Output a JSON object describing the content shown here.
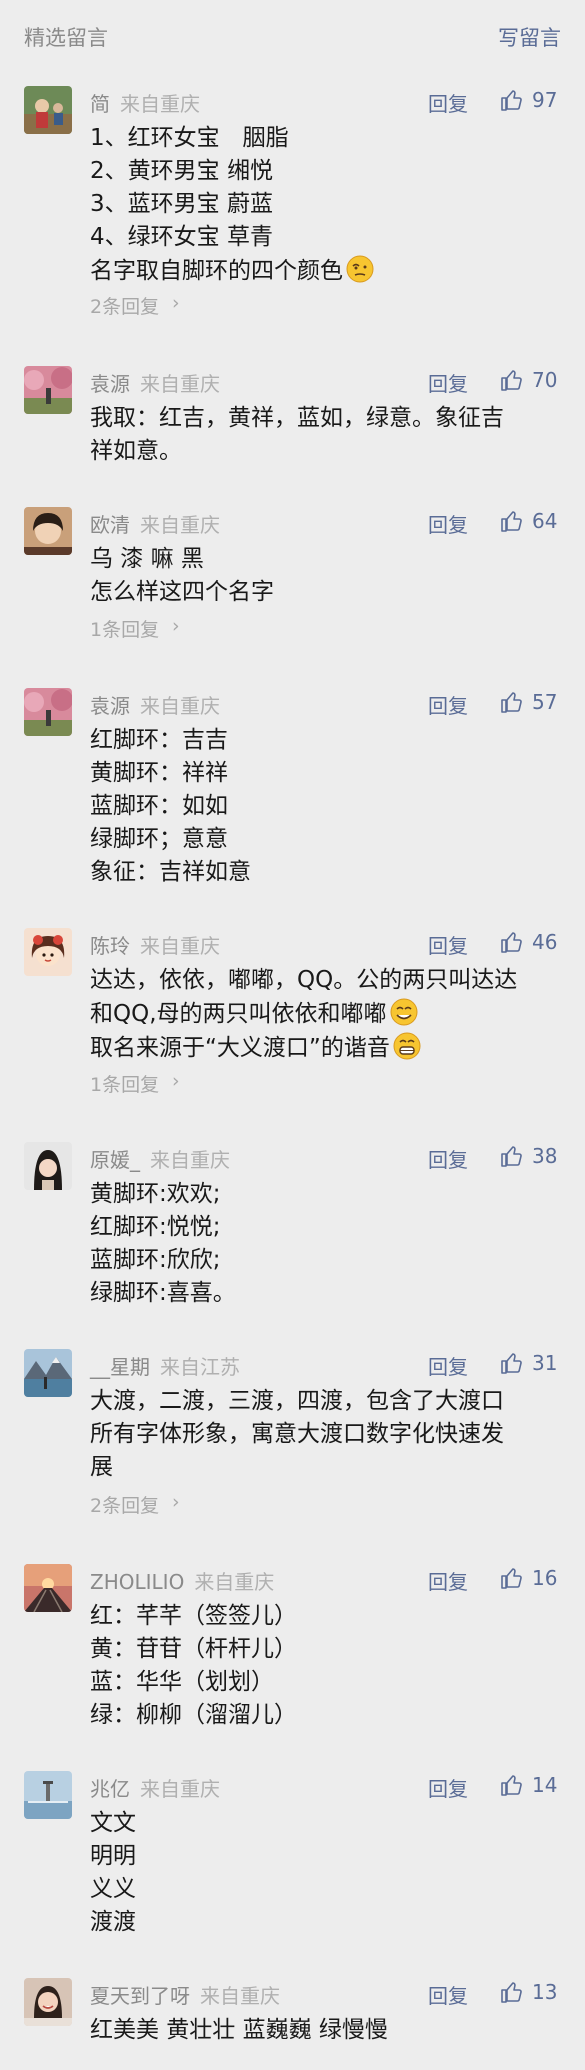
{
  "header": {
    "title": "精选留言",
    "write": "写留言"
  },
  "comments": [
    {
      "name": "简",
      "loc": "来自重庆",
      "reply": "回复",
      "likes": "97",
      "lines": [
        "1、红环女宝　胭脂",
        "2、黄环男宝  缃悦",
        "3、蓝环男宝  蔚蓝",
        "4、绿环女宝  草青",
        "名字取自脚环的四个颜色"
      ],
      "more": "2条回复",
      "avatar": "avatar-child-outdoor"
    },
    {
      "name": "袁源",
      "loc": "来自重庆",
      "reply": "回复",
      "likes": "70",
      "lines": [
        "我取：红吉，黄祥，蓝如，绿意。象征吉",
        "祥如意。"
      ],
      "avatar": "avatar-pink-trees"
    },
    {
      "name": "欧清",
      "loc": "来自重庆",
      "reply": "回复",
      "likes": "64",
      "lines": [
        "乌 漆 嘛 黑",
        "怎么样这四个名字"
      ],
      "more": "1条回复",
      "avatar": "avatar-girl-portrait"
    },
    {
      "name": "袁源",
      "loc": "来自重庆",
      "reply": "回复",
      "likes": "57",
      "lines": [
        "红脚环：吉吉",
        "黄脚环：祥祥",
        "蓝脚环：如如",
        "绿脚环；意意",
        "象征：吉祥如意"
      ],
      "avatar": "avatar-pink-trees"
    },
    {
      "name": "陈玲",
      "loc": "来自重庆",
      "reply": "回复",
      "likes": "46",
      "lines": [
        "达达，依依，嘟嘟，QQ。公的两只叫达达",
        "和QQ,母的两只叫依依和嘟嘟",
        "取名来源于“大义渡口”的谐音"
      ],
      "more": "1条回复",
      "avatar": "avatar-cartoon-girl"
    },
    {
      "name": "原媛_",
      "loc": "来自重庆",
      "reply": "回复",
      "likes": "38",
      "lines": [
        "黄脚环:欢欢;",
        "红脚环:悦悦;",
        "蓝脚环:欣欣;",
        "绿脚环:喜喜。"
      ],
      "avatar": "avatar-woman-portrait"
    },
    {
      "name": "__星期",
      "loc": "来自江苏",
      "reply": "回复",
      "likes": "31",
      "lines": [
        "大渡，二渡，三渡，四渡，包含了大渡口",
        "所有字体形象，寓意大渡口数字化快速发",
        "展"
      ],
      "more": "2条回复",
      "avatar": "avatar-mountain-lake"
    },
    {
      "name": "ZHOLILIO",
      "loc": "来自重庆",
      "reply": "回复",
      "likes": "16",
      "lines": [
        "红：芊芊（签签儿）",
        "黄：苷苷（杆杆儿）",
        "蓝：华华（划划）",
        "绿：柳柳（溜溜儿）"
      ],
      "avatar": "avatar-sunset-rail"
    },
    {
      "name": "兆亿",
      "loc": "来自重庆",
      "reply": "回复",
      "likes": "14",
      "lines": [
        "文文",
        "明明",
        "义义",
        "渡渡"
      ],
      "avatar": "avatar-sea-lighthouse"
    },
    {
      "name": "夏天到了呀",
      "loc": "来自重庆",
      "reply": "回复",
      "likes": "13",
      "lines": [
        "红美美 黄壮壮 蓝巍巍 绿慢慢"
      ],
      "avatar": "avatar-smiling-woman"
    }
  ],
  "colors": {
    "link": "#5a6c96",
    "text": "#191919",
    "muted": "#8a8a8a",
    "bg": "#ededed"
  }
}
